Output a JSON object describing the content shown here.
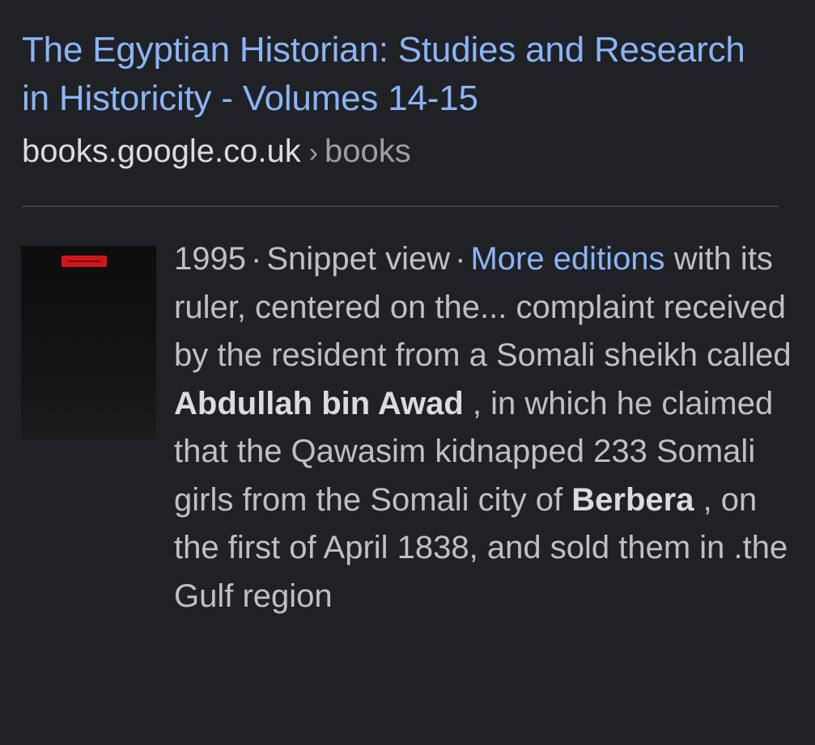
{
  "result": {
    "title": "The Egyptian Historian: Studies and Research in Historicity - Volumes 14-15",
    "source": {
      "domain": "books.google.co.uk",
      "separator": "›",
      "path": "books"
    },
    "meta": {
      "year": "1995",
      "dot": "·",
      "view": "Snippet view",
      "more_editions": "More editions"
    },
    "snippet": {
      "part1": "with its ruler, centered on the... complaint received by the resident from a Somali sheikh called ",
      "highlight1": "Abdullah bin Awad",
      "part2": " , in which he claimed that the Qawasim kidnapped 233 Somali girls from the Somali city of ",
      "highlight2": "Berbera",
      "part3": " , on the first of April 1838, and sold them in .the Gulf region"
    }
  },
  "colors": {
    "background": "#202124",
    "link": "#8ab4f8",
    "text": "#bdc1c6",
    "thumbnail_label": "#d0151b"
  }
}
